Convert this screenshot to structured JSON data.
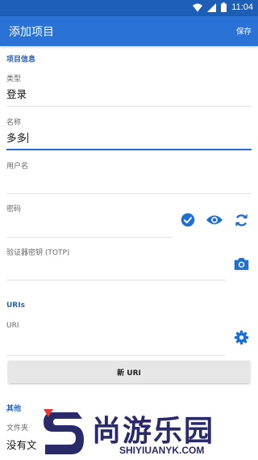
{
  "status_bar": {
    "time": "11:04"
  },
  "app_bar": {
    "title": "添加项目",
    "save_label": "保存"
  },
  "item_info": {
    "section_title": "项目信息",
    "type": {
      "label": "类型",
      "value": "登录"
    },
    "name": {
      "label": "名称",
      "value": "多多"
    },
    "username": {
      "label": "用户名",
      "value": ""
    },
    "password": {
      "label": "密码",
      "value": ""
    },
    "totp": {
      "label": "验证器密钥 (TOTP)",
      "value": ""
    }
  },
  "uris": {
    "section_title": "URIs",
    "uri": {
      "label": "URI",
      "value": ""
    },
    "new_uri_label": "新 URI"
  },
  "other": {
    "section_title": "其他",
    "folder": {
      "label": "文件夹",
      "value": "没有文"
    }
  },
  "watermark": {
    "main": "尚游乐园",
    "sub": "SHIYIUANYK.COM"
  },
  "colors": {
    "primary": "#2a72d6",
    "status_bar": "#1d5fb8",
    "accent_icon": "#1e6fd0",
    "section_title": "#2a62b8"
  }
}
